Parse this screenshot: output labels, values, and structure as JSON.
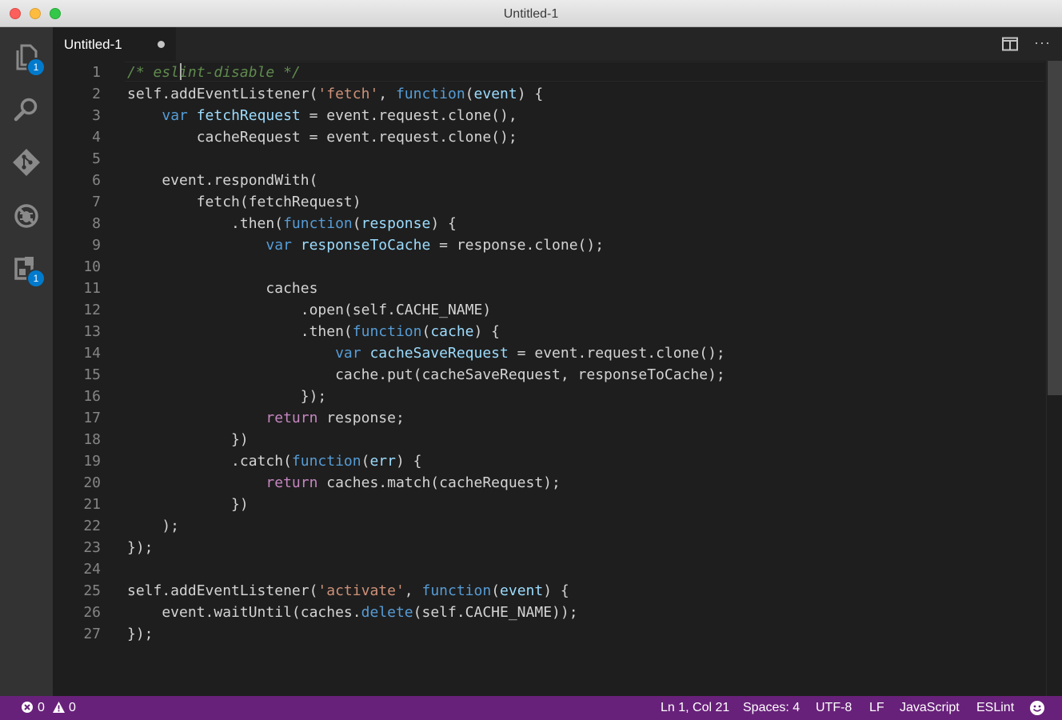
{
  "window": {
    "title": "Untitled-1"
  },
  "activity_bar": {
    "items": [
      {
        "name": "explorer",
        "icon": "files-icon",
        "badge": "1"
      },
      {
        "name": "search",
        "icon": "search-icon",
        "badge": ""
      },
      {
        "name": "git",
        "icon": "git-icon",
        "badge": ""
      },
      {
        "name": "debug",
        "icon": "debug-icon",
        "badge": ""
      },
      {
        "name": "extensions",
        "icon": "extensions-icon",
        "badge": "1"
      }
    ]
  },
  "tabs": [
    {
      "label": "Untitled-1",
      "dirty": true
    }
  ],
  "editor_actions": {
    "split_icon": "split-editor-icon",
    "more_icon": "more-actions-icon",
    "more_glyph": "···"
  },
  "editor": {
    "line_numbers": [
      "1",
      "2",
      "3",
      "4",
      "5",
      "6",
      "7",
      "8",
      "9",
      "10",
      "11",
      "12",
      "13",
      "14",
      "15",
      "16",
      "17",
      "18",
      "19",
      "20",
      "21",
      "22",
      "23",
      "24",
      "25",
      "26",
      "27"
    ],
    "lines": [
      [
        [
          "comment",
          "/* eslint-disable */"
        ]
      ],
      [
        [
          "plain",
          "self.addEventListener("
        ],
        [
          "string",
          "'fetch'"
        ],
        [
          "plain",
          ", "
        ],
        [
          "keyword",
          "function"
        ],
        [
          "plain",
          "("
        ],
        [
          "param",
          "event"
        ],
        [
          "plain",
          ") {"
        ]
      ],
      [
        [
          "plain",
          "    "
        ],
        [
          "keyword",
          "var"
        ],
        [
          "plain",
          " "
        ],
        [
          "param",
          "fetchRequest"
        ],
        [
          "plain",
          " = event.request.clone(),"
        ]
      ],
      [
        [
          "plain",
          "        cacheRequest = event.request.clone();"
        ]
      ],
      [],
      [
        [
          "plain",
          "    event.respondWith("
        ]
      ],
      [
        [
          "plain",
          "        fetch(fetchRequest)"
        ]
      ],
      [
        [
          "plain",
          "            .then("
        ],
        [
          "keyword",
          "function"
        ],
        [
          "plain",
          "("
        ],
        [
          "param",
          "response"
        ],
        [
          "plain",
          ") {"
        ]
      ],
      [
        [
          "plain",
          "                "
        ],
        [
          "keyword",
          "var"
        ],
        [
          "plain",
          " "
        ],
        [
          "param",
          "responseToCache"
        ],
        [
          "plain",
          " = response.clone();"
        ]
      ],
      [],
      [
        [
          "plain",
          "                caches"
        ]
      ],
      [
        [
          "plain",
          "                    .open(self.CACHE_NAME)"
        ]
      ],
      [
        [
          "plain",
          "                    .then("
        ],
        [
          "keyword",
          "function"
        ],
        [
          "plain",
          "("
        ],
        [
          "param",
          "cache"
        ],
        [
          "plain",
          ") {"
        ]
      ],
      [
        [
          "plain",
          "                        "
        ],
        [
          "keyword",
          "var"
        ],
        [
          "plain",
          " "
        ],
        [
          "param",
          "cacheSaveRequest"
        ],
        [
          "plain",
          " = event.request.clone();"
        ]
      ],
      [
        [
          "plain",
          "                        cache.put(cacheSaveRequest, responseToCache);"
        ]
      ],
      [
        [
          "plain",
          "                    });"
        ]
      ],
      [
        [
          "plain",
          "                "
        ],
        [
          "control",
          "return"
        ],
        [
          "plain",
          " response;"
        ]
      ],
      [
        [
          "plain",
          "            })"
        ]
      ],
      [
        [
          "plain",
          "            .catch("
        ],
        [
          "keyword",
          "function"
        ],
        [
          "plain",
          "("
        ],
        [
          "param",
          "err"
        ],
        [
          "plain",
          ") {"
        ]
      ],
      [
        [
          "plain",
          "                "
        ],
        [
          "control",
          "return"
        ],
        [
          "plain",
          " caches.match(cacheRequest);"
        ]
      ],
      [
        [
          "plain",
          "            })"
        ]
      ],
      [
        [
          "plain",
          "    );"
        ]
      ],
      [
        [
          "plain",
          "});"
        ]
      ],
      [],
      [
        [
          "plain",
          "self.addEventListener("
        ],
        [
          "string",
          "'activate'"
        ],
        [
          "plain",
          ", "
        ],
        [
          "keyword",
          "function"
        ],
        [
          "plain",
          "("
        ],
        [
          "param",
          "event"
        ],
        [
          "plain",
          ") {"
        ]
      ],
      [
        [
          "plain",
          "    event.waitUntil(caches."
        ],
        [
          "keyword",
          "delete"
        ],
        [
          "plain",
          "(self.CACHE_NAME));"
        ]
      ],
      [
        [
          "plain",
          "});"
        ]
      ]
    ]
  },
  "status_bar": {
    "errors": "0",
    "warnings": "0",
    "position": "Ln 1, Col 21",
    "indentation": "Spaces: 4",
    "encoding": "UTF-8",
    "eol": "LF",
    "language": "JavaScript",
    "linter": "ESLint",
    "feedback_icon": "smiley-icon",
    "color": "#68217a"
  }
}
